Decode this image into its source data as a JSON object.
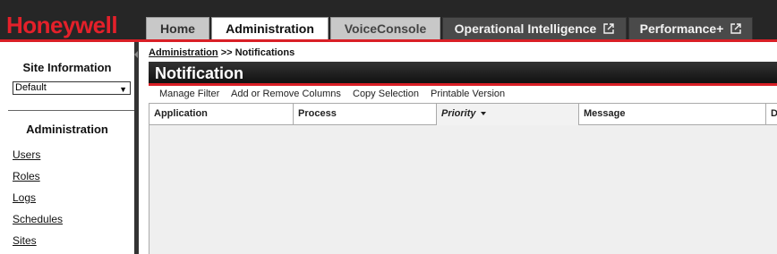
{
  "brand": {
    "logo_text": "Honeywell",
    "accent_color": "#d91f26"
  },
  "nav": {
    "tabs": [
      {
        "label": "Home"
      },
      {
        "label": "Administration",
        "active": true
      },
      {
        "label": "VoiceConsole"
      },
      {
        "label": "Operational Intelligence",
        "icon": "external-link-icon"
      },
      {
        "label": "Performance+",
        "icon": "external-link-icon"
      }
    ]
  },
  "sidebar": {
    "site_title": "Site Information",
    "site_select_value": "Default",
    "admin_title": "Administration",
    "links": [
      "Users",
      "Roles",
      "Logs",
      "Schedules",
      "Sites"
    ]
  },
  "breadcrumb": {
    "link": "Administration",
    "separator": ">>",
    "current": "Notifications"
  },
  "page": {
    "title": "Notification"
  },
  "toolbar": {
    "items": [
      "Manage Filter",
      "Add or Remove Columns",
      "Copy Selection",
      "Printable Version"
    ]
  },
  "grid": {
    "columns": [
      "Application",
      "Process",
      "Priority",
      "Message",
      "D"
    ],
    "sorted_column": "Priority",
    "sort_direction": "descending"
  }
}
